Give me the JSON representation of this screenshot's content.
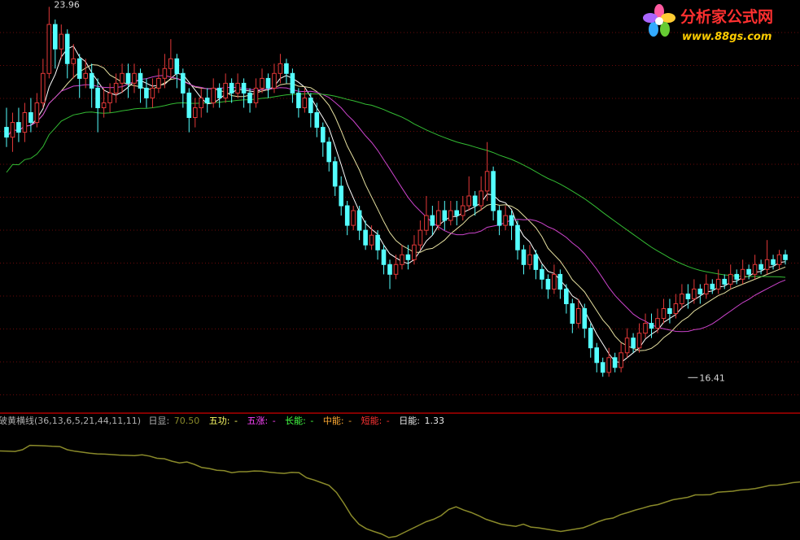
{
  "colors": {
    "background": "#000000",
    "grid": "#6a0a0a",
    "separator": "#b00000",
    "up": "#e23838",
    "down": "#54ffff",
    "ma_short": "#ffffff",
    "ma_mid": "#e6e0a0",
    "ma_purple": "#cc44cc",
    "ma_long": "#33bb33",
    "indicator_line": "#8a8a2a",
    "label_white": "#e8e8e8",
    "label_gray": "#b0b0b0",
    "label_yellow": "#ffff66",
    "label_magenta": "#ff44ff",
    "label_green": "#44ff44",
    "label_orange": "#ffaa33",
    "label_red": "#ff3333"
  },
  "logo": {
    "brand": "分析家公式网",
    "url": "www.88gs.com",
    "icon": "flower-logo-icon"
  },
  "indicator_header": {
    "name": "破黄横线(36,13,6,5,21,44,11,11)",
    "day_label": "日显:",
    "day_value": "70.50",
    "wugong_label": "五功:",
    "wugong_value": "-",
    "wuzhang_label": "五涨:",
    "wuzhang_value": "-",
    "changneng_label": "长能:",
    "changneng_value": "-",
    "zhongneng_label": "中能:",
    "zhongneng_value": "-",
    "duanneng_label": "短能:",
    "duanneng_value": "-",
    "rineng_label": "日能:",
    "rineng_value": "1.33"
  },
  "chart_data": {
    "type": "candlestick",
    "price_range": [
      15.9,
      24.0
    ],
    "annotations": [
      {
        "text": "23.96",
        "kind": "high",
        "bar": 7,
        "price": 23.96
      },
      {
        "text": "16.41",
        "kind": "low",
        "bar": 112,
        "price": 16.41
      }
    ],
    "candles": [
      [
        21.5,
        21.3,
        21.9,
        21.1
      ],
      [
        21.3,
        21.6,
        21.8,
        21.0
      ],
      [
        21.6,
        21.4,
        21.9,
        21.2
      ],
      [
        21.4,
        21.8,
        22.0,
        21.2
      ],
      [
        21.8,
        21.6,
        22.1,
        21.4
      ],
      [
        21.6,
        22.0,
        22.2,
        21.5
      ],
      [
        22.0,
        22.6,
        22.9,
        21.9
      ],
      [
        22.6,
        23.6,
        23.96,
        22.5
      ],
      [
        23.6,
        23.1,
        23.7,
        22.7
      ],
      [
        23.1,
        23.4,
        23.6,
        22.9
      ],
      [
        23.4,
        22.8,
        23.5,
        22.5
      ],
      [
        22.8,
        22.9,
        23.2,
        22.5
      ],
      [
        22.9,
        22.5,
        23.0,
        22.1
      ],
      [
        22.5,
        22.6,
        22.9,
        22.3
      ],
      [
        22.6,
        22.3,
        22.8,
        21.9
      ],
      [
        22.3,
        21.9,
        22.5,
        21.4
      ],
      [
        21.9,
        22.0,
        22.3,
        21.7
      ],
      [
        22.0,
        22.2,
        22.4,
        21.8
      ],
      [
        22.2,
        22.4,
        22.6,
        22.0
      ],
      [
        22.4,
        22.6,
        22.8,
        22.2
      ],
      [
        22.6,
        22.4,
        22.8,
        22.1
      ],
      [
        22.4,
        22.6,
        22.8,
        22.2
      ],
      [
        22.6,
        22.3,
        22.7,
        22.0
      ],
      [
        22.3,
        22.1,
        22.5,
        21.9
      ],
      [
        22.1,
        22.3,
        22.5,
        21.9
      ],
      [
        22.3,
        22.5,
        22.7,
        22.2
      ],
      [
        22.5,
        22.7,
        23.0,
        22.3
      ],
      [
        22.7,
        22.9,
        23.3,
        22.5
      ],
      [
        22.9,
        22.6,
        23.0,
        22.3
      ],
      [
        22.6,
        22.2,
        22.7,
        21.9
      ],
      [
        22.2,
        21.7,
        22.3,
        21.4
      ],
      [
        21.7,
        21.9,
        22.1,
        21.5
      ],
      [
        21.9,
        22.1,
        22.3,
        21.7
      ],
      [
        22.1,
        22.0,
        22.3,
        21.8
      ],
      [
        22.0,
        22.3,
        22.5,
        21.9
      ],
      [
        22.3,
        22.1,
        22.4,
        21.9
      ],
      [
        22.1,
        22.4,
        22.6,
        22.0
      ],
      [
        22.4,
        22.2,
        22.5,
        22.0
      ],
      [
        22.2,
        22.4,
        22.6,
        22.1
      ],
      [
        22.4,
        22.2,
        22.5,
        21.9
      ],
      [
        22.2,
        22.0,
        22.3,
        21.8
      ],
      [
        22.0,
        22.3,
        22.5,
        21.9
      ],
      [
        22.3,
        22.5,
        22.7,
        22.2
      ],
      [
        22.5,
        22.3,
        22.6,
        22.1
      ],
      [
        22.3,
        22.6,
        22.8,
        22.2
      ],
      [
        22.6,
        22.8,
        23.0,
        22.4
      ],
      [
        22.8,
        22.6,
        22.9,
        22.4
      ],
      [
        22.6,
        22.2,
        22.7,
        22.0
      ],
      [
        22.2,
        21.9,
        22.3,
        21.7
      ],
      [
        21.9,
        22.1,
        22.3,
        21.8
      ],
      [
        22.1,
        21.8,
        22.2,
        21.5
      ],
      [
        21.8,
        21.5,
        22.0,
        21.3
      ],
      [
        21.5,
        21.2,
        21.6,
        20.9
      ],
      [
        21.2,
        20.8,
        21.3,
        20.6
      ],
      [
        20.8,
        20.3,
        20.9,
        20.1
      ],
      [
        20.3,
        19.9,
        20.5,
        19.7
      ],
      [
        19.9,
        19.5,
        20.0,
        19.3
      ],
      [
        19.5,
        19.8,
        19.9,
        19.4
      ],
      [
        19.8,
        19.4,
        19.9,
        19.2
      ],
      [
        19.4,
        19.1,
        19.6,
        19.0
      ],
      [
        19.1,
        19.3,
        19.5,
        19.0
      ],
      [
        19.3,
        19.0,
        19.4,
        18.8
      ],
      [
        19.0,
        18.7,
        19.1,
        18.5
      ],
      [
        18.7,
        18.5,
        18.8,
        18.2
      ],
      [
        18.5,
        18.7,
        18.9,
        18.4
      ],
      [
        18.7,
        18.9,
        19.1,
        18.6
      ],
      [
        18.9,
        18.8,
        19.1,
        18.6
      ],
      [
        18.8,
        19.1,
        19.3,
        18.7
      ],
      [
        19.1,
        19.4,
        19.6,
        19.0
      ],
      [
        19.4,
        19.7,
        20.1,
        19.3
      ],
      [
        19.7,
        19.5,
        19.9,
        19.3
      ],
      [
        19.5,
        19.8,
        20.0,
        19.4
      ],
      [
        19.8,
        19.6,
        20.0,
        19.4
      ],
      [
        19.6,
        19.8,
        20.0,
        19.5
      ],
      [
        19.8,
        19.7,
        20.0,
        19.5
      ],
      [
        19.7,
        19.9,
        20.1,
        19.6
      ],
      [
        19.9,
        20.1,
        20.5,
        19.8
      ],
      [
        20.1,
        19.9,
        20.2,
        19.7
      ],
      [
        19.9,
        20.2,
        20.5,
        19.8
      ],
      [
        20.2,
        20.6,
        21.2,
        20.0
      ],
      [
        20.6,
        19.8,
        20.7,
        19.6
      ],
      [
        19.8,
        19.5,
        19.9,
        19.3
      ],
      [
        19.5,
        19.7,
        19.9,
        19.4
      ],
      [
        19.7,
        19.5,
        19.8,
        19.2
      ],
      [
        19.5,
        19.0,
        19.6,
        18.8
      ],
      [
        19.0,
        18.7,
        19.1,
        18.5
      ],
      [
        18.7,
        18.9,
        19.1,
        18.6
      ],
      [
        18.9,
        18.6,
        19.0,
        18.4
      ],
      [
        18.6,
        18.4,
        18.7,
        18.2
      ],
      [
        18.4,
        18.2,
        18.5,
        18.0
      ],
      [
        18.2,
        18.5,
        18.7,
        18.1
      ],
      [
        18.5,
        18.2,
        18.6,
        18.0
      ],
      [
        18.2,
        17.9,
        18.3,
        17.7
      ],
      [
        17.9,
        17.5,
        18.0,
        17.3
      ],
      [
        17.5,
        17.8,
        18.0,
        17.4
      ],
      [
        17.8,
        17.4,
        17.9,
        17.2
      ],
      [
        17.4,
        17.0,
        17.5,
        16.8
      ],
      [
        17.0,
        16.7,
        17.1,
        16.5
      ],
      [
        16.7,
        16.5,
        16.8,
        16.41
      ],
      [
        16.5,
        16.8,
        17.0,
        16.41
      ],
      [
        16.8,
        16.6,
        16.9,
        16.5
      ],
      [
        16.6,
        16.9,
        17.1,
        16.5
      ],
      [
        16.9,
        17.2,
        17.4,
        16.8
      ],
      [
        17.2,
        17.0,
        17.3,
        16.9
      ],
      [
        17.0,
        17.3,
        17.5,
        16.9
      ],
      [
        17.3,
        17.5,
        17.7,
        17.2
      ],
      [
        17.5,
        17.4,
        17.7,
        17.2
      ],
      [
        17.4,
        17.6,
        17.8,
        17.3
      ],
      [
        17.6,
        17.8,
        18.0,
        17.5
      ],
      [
        17.8,
        17.7,
        18.0,
        17.5
      ],
      [
        17.7,
        17.9,
        18.1,
        17.6
      ],
      [
        17.9,
        18.1,
        18.3,
        17.8
      ],
      [
        18.1,
        18.0,
        18.3,
        17.8
      ],
      [
        18.0,
        18.2,
        18.4,
        17.9
      ],
      [
        18.2,
        18.1,
        18.3,
        17.9
      ],
      [
        18.1,
        18.3,
        18.5,
        18.0
      ],
      [
        18.3,
        18.2,
        18.4,
        18.1
      ],
      [
        18.2,
        18.4,
        18.6,
        18.1
      ],
      [
        18.4,
        18.3,
        18.5,
        18.2
      ],
      [
        18.3,
        18.5,
        18.7,
        18.2
      ],
      [
        18.5,
        18.4,
        18.6,
        18.3
      ],
      [
        18.4,
        18.6,
        18.8,
        18.3
      ],
      [
        18.6,
        18.5,
        18.7,
        18.4
      ],
      [
        18.5,
        18.7,
        18.9,
        18.4
      ],
      [
        18.7,
        18.6,
        18.8,
        18.5
      ],
      [
        18.6,
        18.8,
        19.2,
        18.5
      ],
      [
        18.8,
        18.7,
        18.9,
        18.6
      ],
      [
        18.7,
        18.9,
        19.0,
        18.6
      ],
      [
        18.9,
        18.8,
        19.0,
        18.7
      ]
    ],
    "moving_averages": [
      {
        "key": "ma5",
        "color": "#ffffff",
        "period": 5
      },
      {
        "key": "ma10",
        "color": "#e6e0a0",
        "period": 10
      },
      {
        "key": "ma20",
        "color": "#cc44cc",
        "period": 20
      },
      {
        "key": "ma60",
        "color": "#33bb33",
        "period": 60
      }
    ],
    "indicator": {
      "values": [
        70.5,
        70.4,
        70.3,
        71.0,
        72.8,
        72.7,
        72.6,
        72.4,
        72.3,
        71.0,
        70.4,
        70.0,
        69.6,
        69.3,
        69.2,
        69.0,
        68.8,
        68.7,
        68.6,
        68.9,
        68.4,
        67.5,
        67.3,
        66.3,
        65.6,
        66.0,
        65.0,
        63.7,
        63.3,
        62.6,
        62.4,
        61.6,
        62.0,
        62.0,
        62.3,
        62.2,
        61.8,
        61.5,
        61.3,
        61.7,
        61.6,
        59.5,
        58.6,
        57.5,
        56.4,
        53.5,
        49.0,
        44.0,
        40.5,
        38.6,
        37.5,
        36.5,
        35.0,
        35.5,
        37.0,
        38.5,
        40.0,
        41.5,
        42.5,
        44.0,
        46.5,
        47.6,
        46.3,
        45.3,
        44.0,
        42.5,
        41.5,
        40.5,
        40.0,
        39.6,
        40.5,
        39.3,
        39.0,
        38.5,
        38.0,
        37.5,
        38.0,
        38.5,
        39.0,
        40.2,
        41.5,
        42.5,
        43.0,
        44.4,
        45.3,
        46.3,
        47.1,
        48.0,
        48.5,
        49.5,
        50.5,
        51.0,
        51.5,
        52.5,
        52.5,
        52.6,
        53.6,
        53.8,
        54.0,
        54.5,
        54.7,
        55.1,
        55.7,
        56.4,
        56.5,
        56.9,
        57.5,
        57.8
      ],
      "range": [
        34,
        80
      ]
    }
  }
}
